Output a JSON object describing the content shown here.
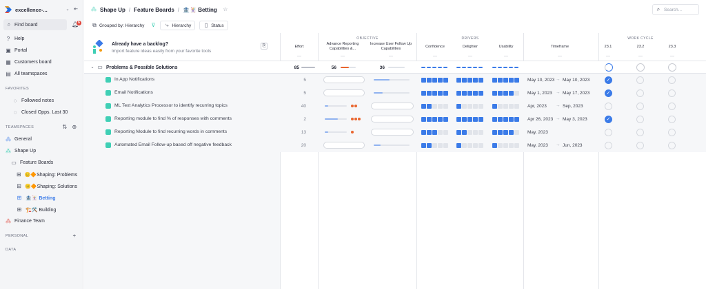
{
  "sidebar": {
    "workspace": "excellence-...",
    "find_board": "Find board",
    "notif_count": "6",
    "nav": [
      {
        "label": "Help",
        "icon": "help-icon"
      },
      {
        "label": "Portal",
        "icon": "portal-icon"
      },
      {
        "label": "Customers board",
        "icon": "customers-icon"
      },
      {
        "label": "All teamspaces",
        "icon": "teamspaces-icon"
      }
    ],
    "favorites_head": "FAVORITES",
    "favorites": [
      {
        "label": "Followed notes"
      },
      {
        "label": "Closed Opps. Last 30"
      }
    ],
    "teamspaces_head": "TEAMSPACES",
    "teamspaces": [
      {
        "label": "General"
      },
      {
        "label": "Shape Up"
      },
      {
        "label": "Feature Boards"
      },
      {
        "label": "😑🔶Shaping: Problems"
      },
      {
        "label": "😑🔶Shaping: Solutions"
      },
      {
        "label": "🏦🃏 Betting"
      },
      {
        "label": "🏗️🛠️ Building"
      },
      {
        "label": "Finance Team"
      }
    ],
    "personal_head": "PERSONAL",
    "data_head": "DATA"
  },
  "topbar": {
    "crumb1": "Shape Up",
    "crumb2": "Feature Boards",
    "crumb3": "🏦🃏 Betting",
    "sep": "/",
    "search_placeholder": "Search..."
  },
  "toolbar": {
    "grouped": "Grouped by: Hierarchy",
    "hierarchy": "Hierarchy",
    "status": "Status"
  },
  "board": {
    "banner_title": "Already have a backlog?",
    "banner_sub": "Import feature ideas easily from your favorite tools",
    "groups": {
      "objective": "OBJECTIVE",
      "drivers": "DRIVERS",
      "work_cycle": "WORK CYCLE"
    },
    "columns": {
      "effort": "Effort",
      "adv_reporting": "Advance Reporting Capabilities &...",
      "increase_user": "Increase User Follow Up Capabilities",
      "confidence": "Confidence",
      "delighter": "Delighter",
      "usability": "Usability",
      "timeframe": "Timeframe",
      "c231": "23.1",
      "c232": "23.2",
      "c233": "23.3",
      "dots": "---"
    },
    "group_row": {
      "title": "Problems & Possible Solutions",
      "effort": "85",
      "adv": "56",
      "inc": "36"
    },
    "arrow": "→",
    "rows": [
      {
        "title": "In App Notifications",
        "effort": "5",
        "adv_fill": 0,
        "adv_dots": 0,
        "inc_fill": 0.45,
        "conf": 5,
        "deli": 5,
        "usab": 5,
        "tf_start": "May 10, 2023",
        "tf_end": "May 10, 2023",
        "c231": true
      },
      {
        "title": "Email Notifications",
        "effort": "5",
        "adv_fill": 0,
        "adv_dots": 0,
        "inc_fill": 0.25,
        "conf": 5,
        "deli": 5,
        "usab": 4,
        "tf_start": "May 1, 2023",
        "tf_end": "May 17, 2023",
        "c231": true
      },
      {
        "title": "ML Text Analytics Processor to identify recurring topics",
        "effort": "40",
        "adv_fill": 0.15,
        "adv_dots": 2,
        "inc_fill": 0,
        "conf": 2,
        "deli": 1,
        "usab": 1,
        "tf_start": "Apr, 2023",
        "tf_end": "Sep, 2023",
        "c231": false
      },
      {
        "title": "Reporting module to find % of responses with comments",
        "effort": "2",
        "adv_fill": 0.6,
        "adv_dots": 3,
        "inc_fill": 0,
        "conf": 5,
        "deli": 5,
        "usab": 5,
        "tf_start": "Apr 26, 2023",
        "tf_end": "May 3, 2023",
        "c231": true
      },
      {
        "title": "Reporting Module to find recurring words in comments",
        "effort": "13",
        "adv_fill": 0.15,
        "adv_dots": 1,
        "inc_fill": 0,
        "conf": 3,
        "deli": 2,
        "usab": 4,
        "tf_start": "May, 2023",
        "tf_end": "",
        "c231": false
      },
      {
        "title": "Automated Email Follow-up based off negative feedback",
        "effort": "20",
        "adv_fill": 0,
        "adv_dots": 0,
        "inc_fill": 0.2,
        "conf": 2,
        "deli": 1,
        "usab": 1,
        "tf_start": "May, 2023",
        "tf_end": "Jun, 2023",
        "c231": false
      }
    ],
    "colors": {
      "accent": "#3b7be8",
      "block_off": "#e1e4ea",
      "orange": "#e9652e",
      "teal": "#3fcfb5"
    }
  }
}
